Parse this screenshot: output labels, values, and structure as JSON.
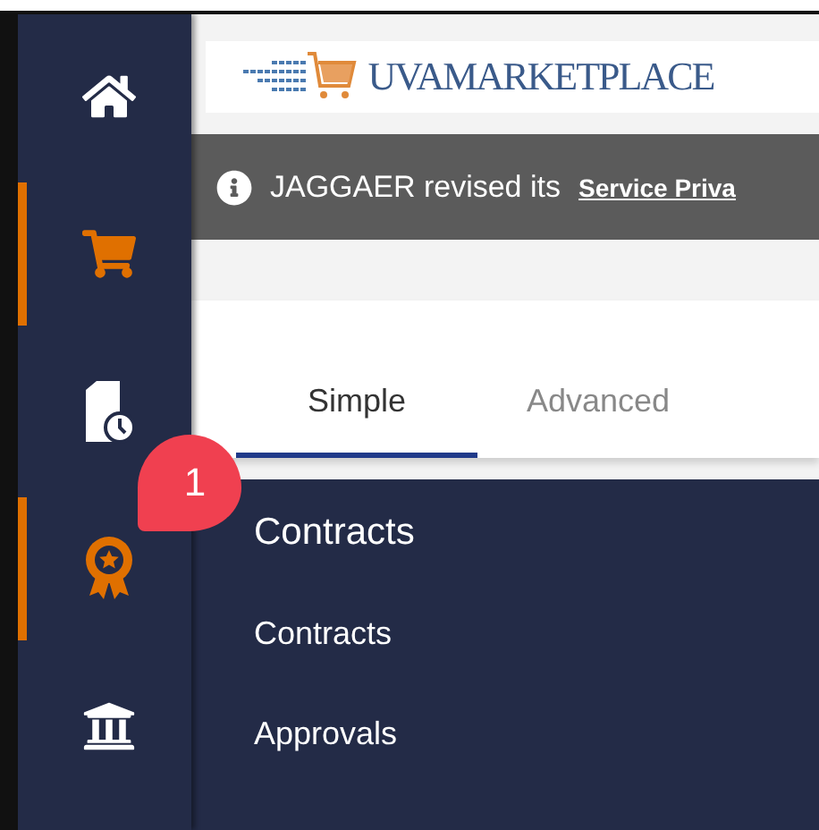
{
  "sidebar": {
    "items": [
      {
        "kind": "home",
        "selected": false
      },
      {
        "kind": "cart",
        "selected": true
      },
      {
        "kind": "history",
        "selected": false
      },
      {
        "kind": "award",
        "selected": true
      },
      {
        "kind": "bank",
        "selected": false
      }
    ]
  },
  "logo": {
    "text": "UVAMARKETPLACE"
  },
  "banner": {
    "text": "JAGGAER revised its ",
    "link": "Service Priva"
  },
  "tabs": [
    {
      "label": "Simple",
      "selected": true
    },
    {
      "label": "Advanced",
      "selected": false
    }
  ],
  "callout": {
    "number": "1"
  },
  "menu": {
    "heading": "Contracts",
    "items": [
      "Contracts",
      "Approvals"
    ]
  }
}
